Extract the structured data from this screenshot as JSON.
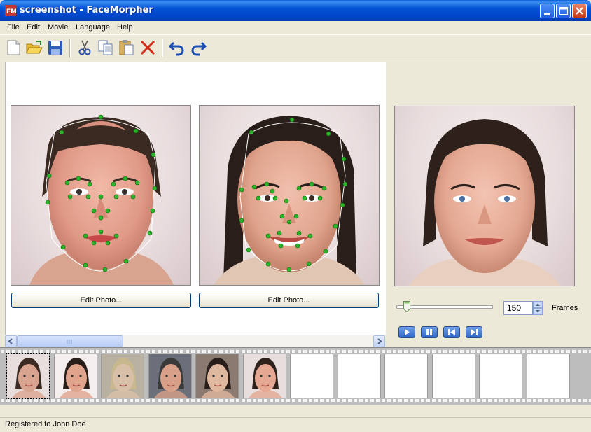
{
  "window": {
    "title": "screenshot - FaceMorpher",
    "app_icon": "facemorpher-icon",
    "controls": [
      "minimize-icon",
      "maximize-icon",
      "close-icon"
    ]
  },
  "menu": {
    "items": [
      {
        "label": "File",
        "accel": "F"
      },
      {
        "label": "Edit",
        "accel": "E"
      },
      {
        "label": "Movie",
        "accel": "M"
      },
      {
        "label": "Language",
        "accel": "L"
      },
      {
        "label": "Help",
        "accel": "H"
      }
    ]
  },
  "toolbar": {
    "icons": [
      "new-icon",
      "open-icon",
      "save-icon",
      "cut-icon",
      "copy-icon",
      "paste-icon",
      "delete-icon",
      "undo-icon",
      "redo-icon"
    ]
  },
  "photos": {
    "left": {
      "edit_label": "Edit Photo..."
    },
    "right": {
      "edit_label": "Edit Photo..."
    }
  },
  "preview": {
    "frames_value": "150",
    "frames_label": "Frames",
    "slider_fraction": 0.12,
    "playback": [
      "play-icon",
      "pause-icon",
      "prev-icon",
      "next-icon"
    ]
  },
  "filmstrip": {
    "frames": [
      "face",
      "face",
      "face",
      "face",
      "face",
      "face",
      "empty",
      "empty",
      "empty",
      "empty",
      "empty",
      "empty"
    ],
    "selected_index": 0
  },
  "status": {
    "text": "Registered to John Doe"
  },
  "colors": {
    "title_bar": "#0553d6",
    "landmark_point": "#2bb52b",
    "background": "#ece9d8"
  }
}
